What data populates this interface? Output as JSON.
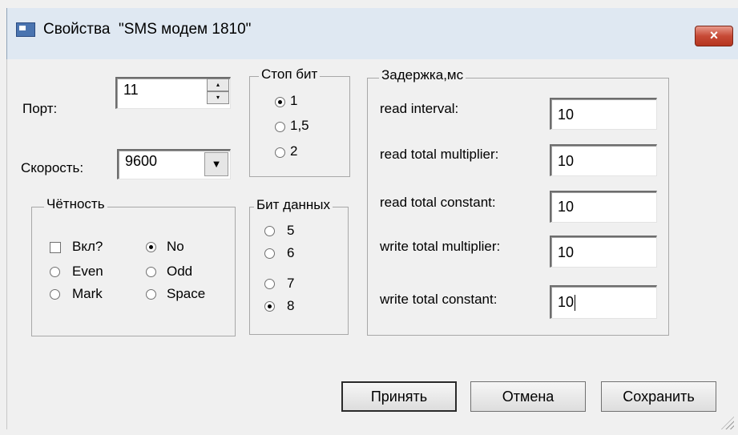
{
  "window": {
    "title": "Свойства  \"SMS модем 1810\"",
    "close_icon": "×"
  },
  "port": {
    "label": "Порт:",
    "value": "11"
  },
  "speed": {
    "label": "Скорость:",
    "value": "9600"
  },
  "stop_bits": {
    "title": "Стоп бит",
    "options": [
      "1",
      "1,5",
      "2"
    ],
    "selected": "1"
  },
  "parity": {
    "title": "Чётность",
    "enable_label": "Вкл?",
    "enabled": false,
    "options": [
      "No",
      "Even",
      "Odd",
      "Mark",
      "Space"
    ],
    "selected": "No"
  },
  "data_bits": {
    "title": "Бит данных",
    "options": [
      "5",
      "6",
      "7",
      "8"
    ],
    "selected": "8"
  },
  "delay": {
    "title": "Задержка,мс",
    "fields": [
      {
        "label": "read interval:",
        "value": "10"
      },
      {
        "label": "read total multiplier:",
        "value": "10"
      },
      {
        "label": "read total constant:",
        "value": "10"
      },
      {
        "label": "write total multiplier:",
        "value": "10"
      },
      {
        "label": "write total constant:",
        "value": "10"
      }
    ]
  },
  "buttons": {
    "accept": "Принять",
    "cancel": "Отмена",
    "save": "Сохранить"
  }
}
